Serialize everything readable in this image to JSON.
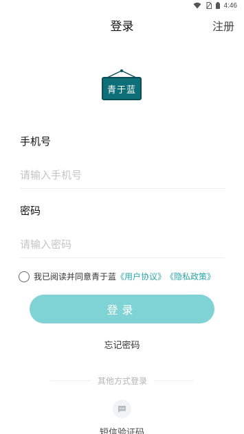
{
  "status_bar": {
    "time": "4:46"
  },
  "nav": {
    "title": "登录",
    "register": "注册"
  },
  "logo": {
    "text": "青于蓝"
  },
  "phone": {
    "label": "手机号",
    "placeholder": "请输入手机号",
    "value": ""
  },
  "password": {
    "label": "密码",
    "placeholder": "请输入密码",
    "value": ""
  },
  "agreement": {
    "prefix": "我已阅读并同意青于蓝",
    "user_agreement": "《用户协议》",
    "privacy_policy": "《隐私政策》",
    "checked": false
  },
  "login_button": "登录",
  "forgot_password": "忘记密码",
  "other_login": {
    "title": "其他方式登录",
    "sms_label": "短信验证码",
    "sms_icon": "message-icon"
  },
  "colors": {
    "accent": "#2aa6a8",
    "button": "#7fd3d4",
    "logo_board": "#0f6f78"
  }
}
